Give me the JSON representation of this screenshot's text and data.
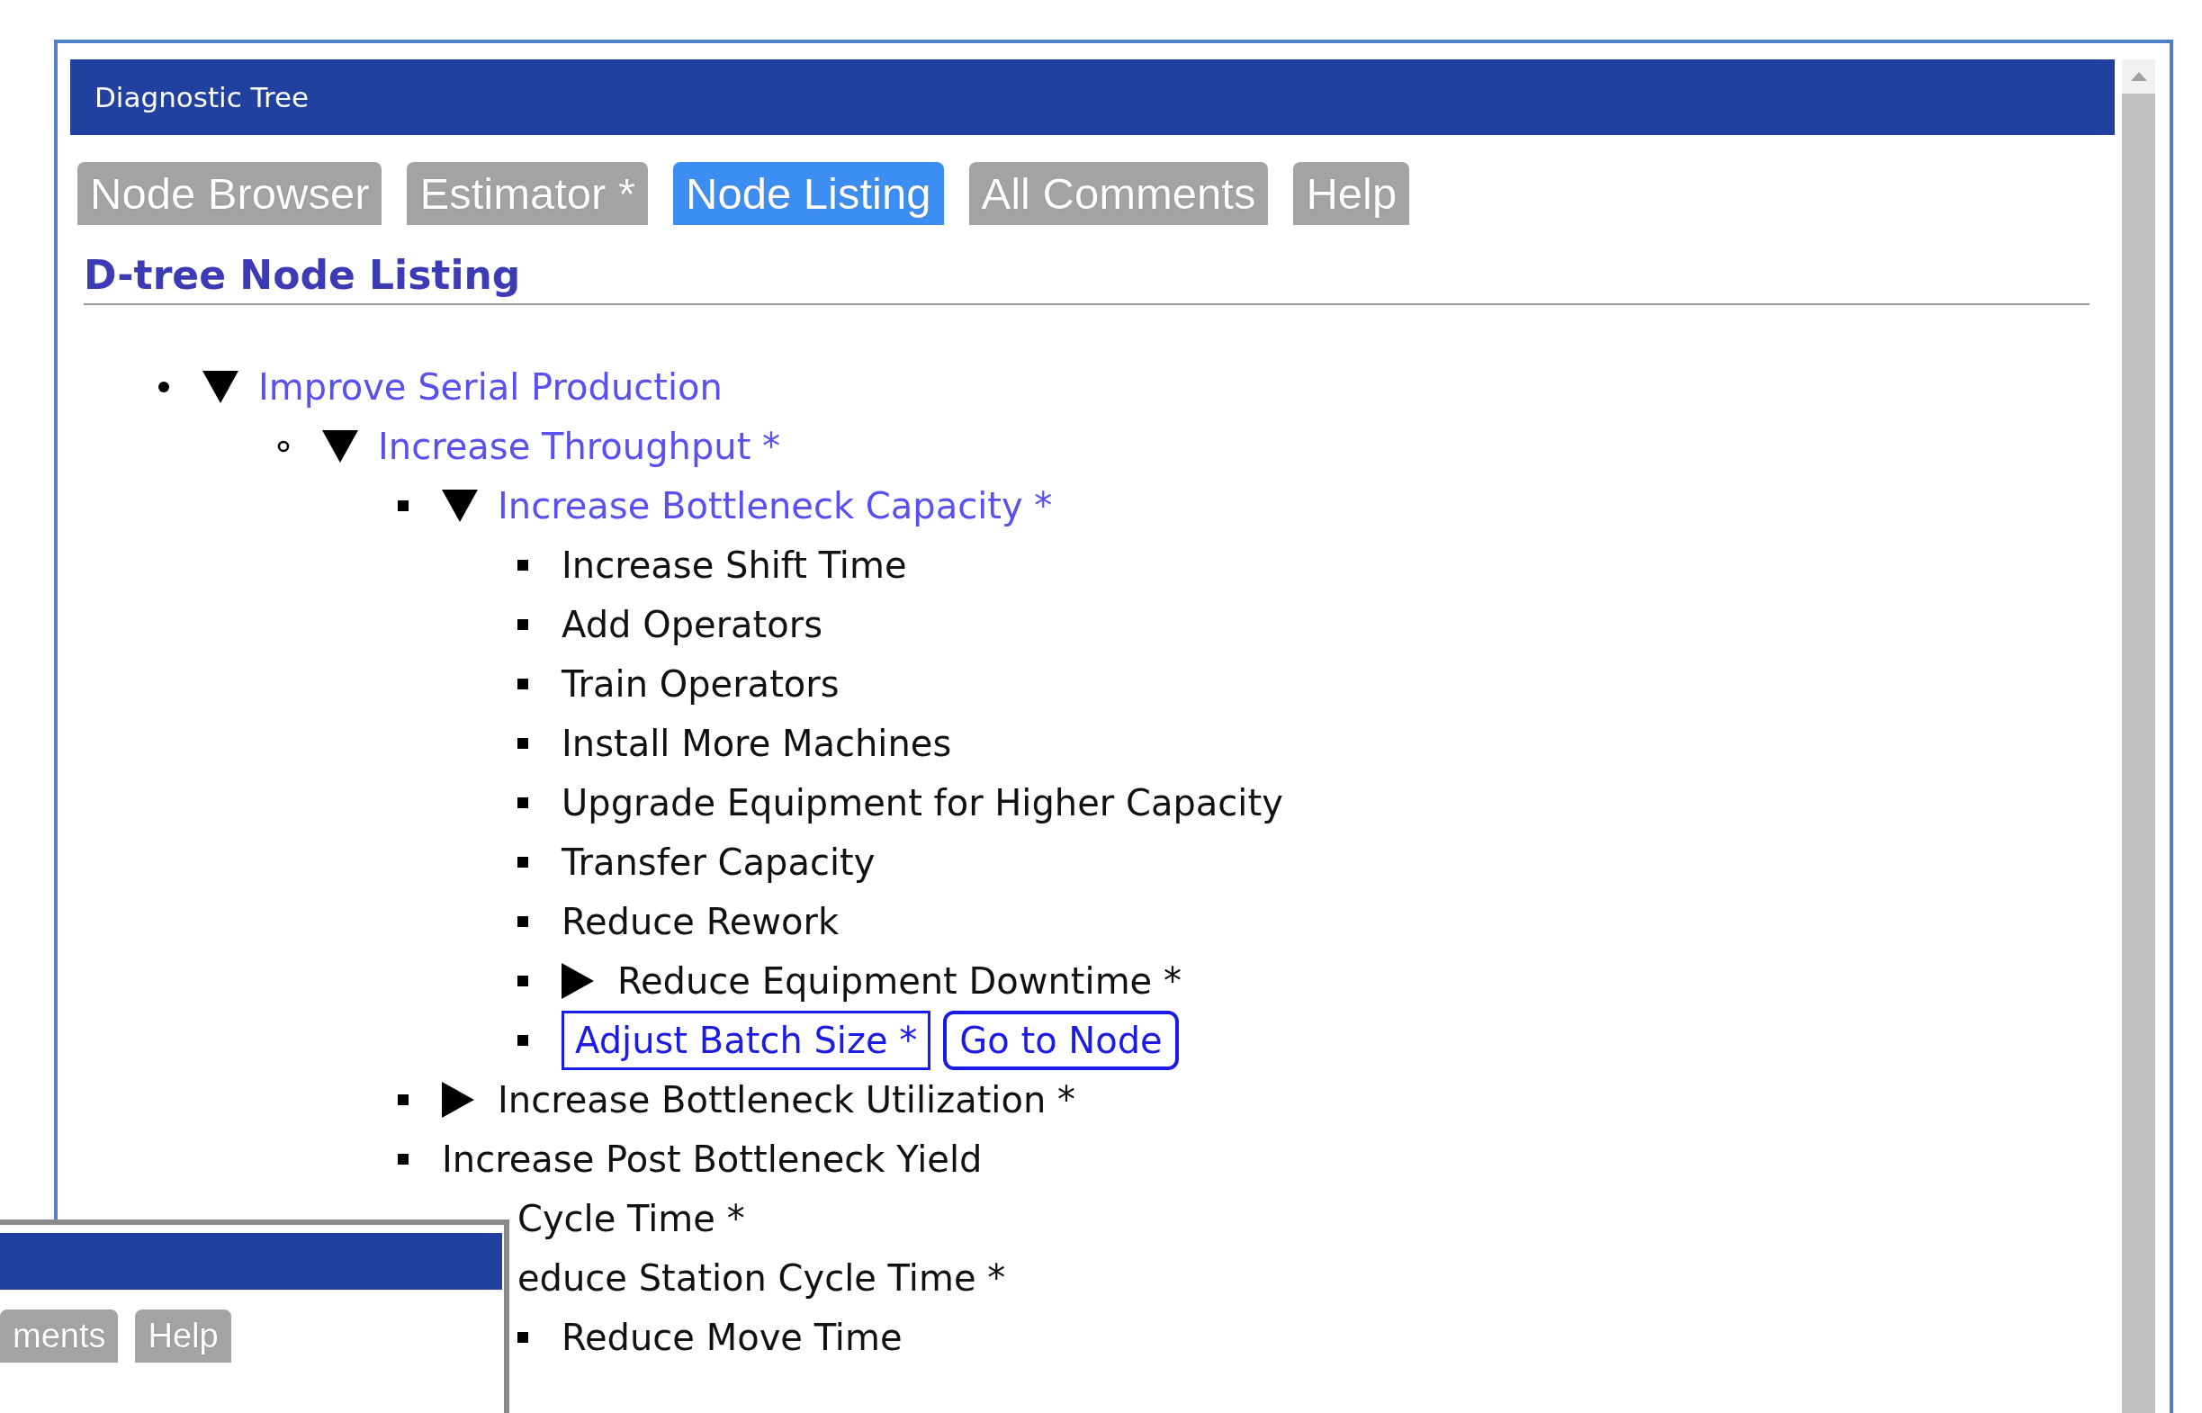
{
  "window": {
    "title": "Diagnostic Tree"
  },
  "tabs": [
    {
      "label": "Node Browser",
      "selected": false
    },
    {
      "label": "Estimator *",
      "selected": false
    },
    {
      "label": "Node Listing",
      "selected": true
    },
    {
      "label": "All Comments",
      "selected": false
    },
    {
      "label": "Help",
      "selected": false
    }
  ],
  "heading": "D-tree Node Listing",
  "tree": [
    {
      "label": "Improve Serial Production",
      "kind": "link",
      "expanded": true,
      "children": [
        {
          "label": "Increase Throughput *",
          "kind": "link",
          "expanded": true,
          "children": [
            {
              "label": "Increase Bottleneck Capacity *",
              "kind": "link",
              "expanded": true,
              "children": [
                {
                  "label": "Increase Shift Time",
                  "kind": "item"
                },
                {
                  "label": "Add Operators",
                  "kind": "item"
                },
                {
                  "label": "Train Operators",
                  "kind": "item"
                },
                {
                  "label": "Install More Machines",
                  "kind": "item"
                },
                {
                  "label": "Upgrade Equipment for Higher Capacity",
                  "kind": "item"
                },
                {
                  "label": "Transfer Capacity",
                  "kind": "item"
                },
                {
                  "label": "Reduce Rework",
                  "kind": "item"
                },
                {
                  "label": "Reduce Equipment Downtime *",
                  "kind": "item",
                  "expanded": false
                },
                {
                  "label": "Adjust Batch Size *",
                  "kind": "current",
                  "action": "Go to Node"
                }
              ]
            },
            {
              "label": "Increase Bottleneck Utilization *",
              "kind": "item",
              "expanded": false
            },
            {
              "label": "Increase Post Bottleneck Yield",
              "kind": "item"
            }
          ]
        },
        {
          "label": "Cycle Time *",
          "kind": "clipped",
          "children": [
            {
              "label": "educe Station Cycle Time *",
              "kind": "clipped",
              "children": [
                {
                  "label": "Reduce Move Time",
                  "kind": "item"
                }
              ]
            }
          ]
        }
      ]
    }
  ],
  "overlay_window": {
    "tabs": [
      {
        "label": "ments",
        "selected": false
      },
      {
        "label": "Help",
        "selected": false
      }
    ]
  }
}
